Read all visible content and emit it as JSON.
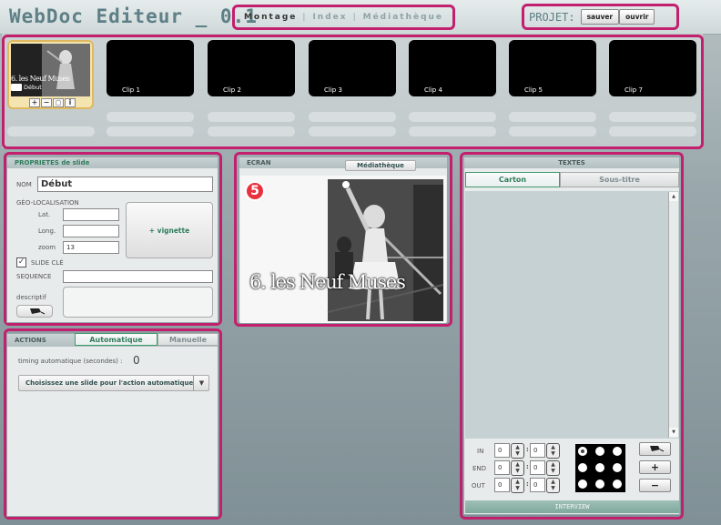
{
  "app": {
    "title": "WebDoc Editeur _ 0.1"
  },
  "nav": {
    "tabs": [
      "Montage",
      "Index",
      "Médiathèque"
    ],
    "separator": "|"
  },
  "projet": {
    "label": "PROJET:",
    "save": "sauver",
    "open": "ouvrir"
  },
  "timeline": {
    "first_clip": {
      "caption": "6. les Neuf Muses",
      "name": "Début",
      "tools": [
        "+",
        "−",
        "▢",
        "i"
      ]
    },
    "clips": [
      "Clip 1",
      "Clip 2",
      "Clip 3",
      "Clip 4",
      "Clip 5",
      "Clip 7"
    ]
  },
  "props": {
    "title": "PROPRIETES de slide",
    "nom_label": "NOM",
    "nom_value": "Début",
    "geo_label": "GÉO-LOCALISATION",
    "lat_label": "Lat.",
    "long_label": "Long.",
    "zoom_label": "zoom",
    "zoom_value": "13",
    "vignette_button": "+ vignette",
    "slide_cle_label": "SLIDE CLÉ",
    "slide_cle_checked": true,
    "sequence_label": "SEQUENCE",
    "descriptif_label": "descriptif"
  },
  "actions": {
    "title": "ACTIONS",
    "tabs": [
      "Automatique",
      "Manuelle"
    ],
    "timing_label": "timing automatique (secondes) :",
    "timing_value": "0",
    "select_text": "Choisissez une slide pour l'action automatique",
    "select_arrow": "▼"
  },
  "ecran": {
    "title": "ECRAN",
    "media_button": "Médiathèque",
    "badge": "5",
    "caption": "6. les Neuf Muses"
  },
  "textes": {
    "title": "TEXTES",
    "tabs": [
      "Carton",
      "Sous-titre"
    ],
    "time_labels": [
      "IN",
      "END",
      "OUT"
    ],
    "time_values": [
      [
        "0",
        "0"
      ],
      [
        "0",
        "0"
      ],
      [
        "0",
        "0"
      ]
    ],
    "colon": ":",
    "plus": "+",
    "minus": "−",
    "footer": "INTERVIEW",
    "scroll_up": "▲",
    "scroll_down": "▼"
  },
  "icons": {
    "eraser": "eraser-icon",
    "chevron": "chevron-down-icon"
  },
  "colors": {
    "highlight": "#c2206e",
    "accent_green": "#2f7d5c",
    "title_teal": "#5d7f86"
  }
}
